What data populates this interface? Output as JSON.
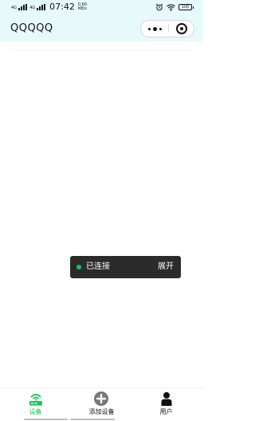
{
  "status_bar": {
    "signal1": "4G",
    "signal2": "4G",
    "time": "07:42",
    "net_speed_value": "0.60",
    "net_speed_unit": "KB/s",
    "battery": "100"
  },
  "nav": {
    "title": "QQQQQ"
  },
  "toast": {
    "status": "已连接",
    "expand_label": "展开",
    "status_color": "#18c35a"
  },
  "tabs": [
    {
      "label": "设备",
      "icon": "router-icon",
      "active": true
    },
    {
      "label": "添加设备",
      "icon": "plus-circle-icon",
      "active": false
    },
    {
      "label": "用户",
      "icon": "user-icon",
      "active": false
    }
  ],
  "colors": {
    "header_bg": "#e7fafb",
    "accent": "#18c35a",
    "toast_bg": "#2b2b2b",
    "inactive_icon": "#777777"
  }
}
